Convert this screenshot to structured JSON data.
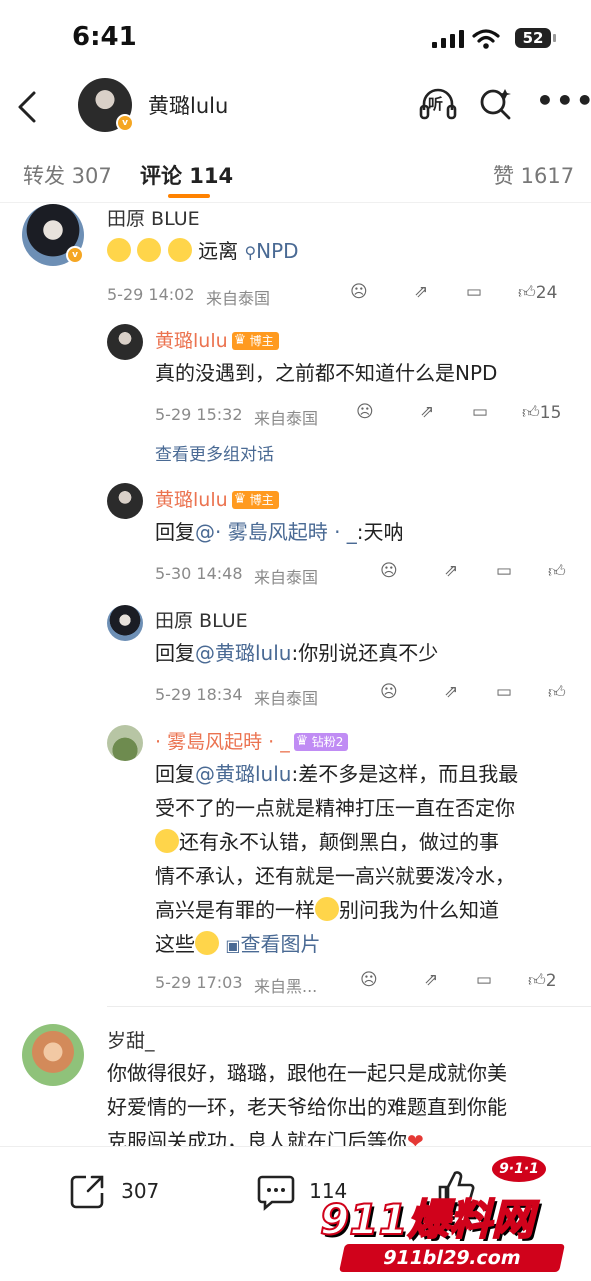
{
  "status": {
    "time": "6:41",
    "battery": "52"
  },
  "header": {
    "author": "黄璐lulu",
    "listen": "听"
  },
  "tabs": [
    {
      "label": "转发 307"
    },
    {
      "label": "评论 114"
    },
    {
      "label": "赞 1617"
    }
  ],
  "comments": [
    {
      "name": "田原 BLUE",
      "text_suffix": "远离",
      "search_link": "NPD",
      "date": "5-29 14:02",
      "source": "来自泰国",
      "likes": "24",
      "replies": [
        {
          "name": "黄璐lulu",
          "tag": "博主",
          "text": "真的没遇到，之前都不知道什么是NPD",
          "date": "5-29 15:32",
          "source": "来自泰国",
          "likes": "15"
        }
      ],
      "more": "查看更多组对话"
    },
    {
      "reply2": {
        "name": "黄璐lulu",
        "tag": "博主",
        "prefix": "回复",
        "mention": "@· 雾島风起時 · _",
        "text": ":天呐",
        "date": "5-30 14:48",
        "source": "来自泰国"
      }
    },
    {
      "reply3": {
        "name": "田原 BLUE",
        "prefix": "回复",
        "mention": "@黄璐lulu",
        "text": ":你别说还真不少",
        "date": "5-29 18:34",
        "source": "来自泰国"
      }
    },
    {
      "reply4": {
        "name": "· 雾島风起時 · _",
        "tag": "钻粉2",
        "prefix": "回复",
        "mention": "@黄璐lulu",
        "line1": ":差不多是这样，而且我最",
        "line2": "受不了的一点就是精神打压一直在否定你",
        "line3": "还有永不认错，颠倒黑白，做过的事",
        "line4": "情不承认，还有就是一高兴就要泼冷水，",
        "line5": "高兴是有罪的一样",
        "line5b": "别问我为什么知道",
        "line6": "这些",
        "image_link": "查看图片",
        "date": "5-29 17:03",
        "source": "来自黑...",
        "likes": "2"
      }
    },
    {
      "top2": {
        "name": "岁甜_",
        "line1": "你做得很好，璐璐，跟他在一起只是成就你美",
        "line2": "好爱情的一环，老天爷给你出的难题直到你能",
        "line3": "克服闯关成功，良人就在门后等你"
      }
    }
  ],
  "bottom": {
    "repost_count": "307",
    "comment_count": "114"
  },
  "watermark": {
    "brand": "911爆料网",
    "badge": "9·1·1",
    "url": "911bl29.com"
  },
  "colors": {
    "accent": "#ff8200",
    "link": "#4a6a94",
    "orange_name": "#eb7350"
  }
}
